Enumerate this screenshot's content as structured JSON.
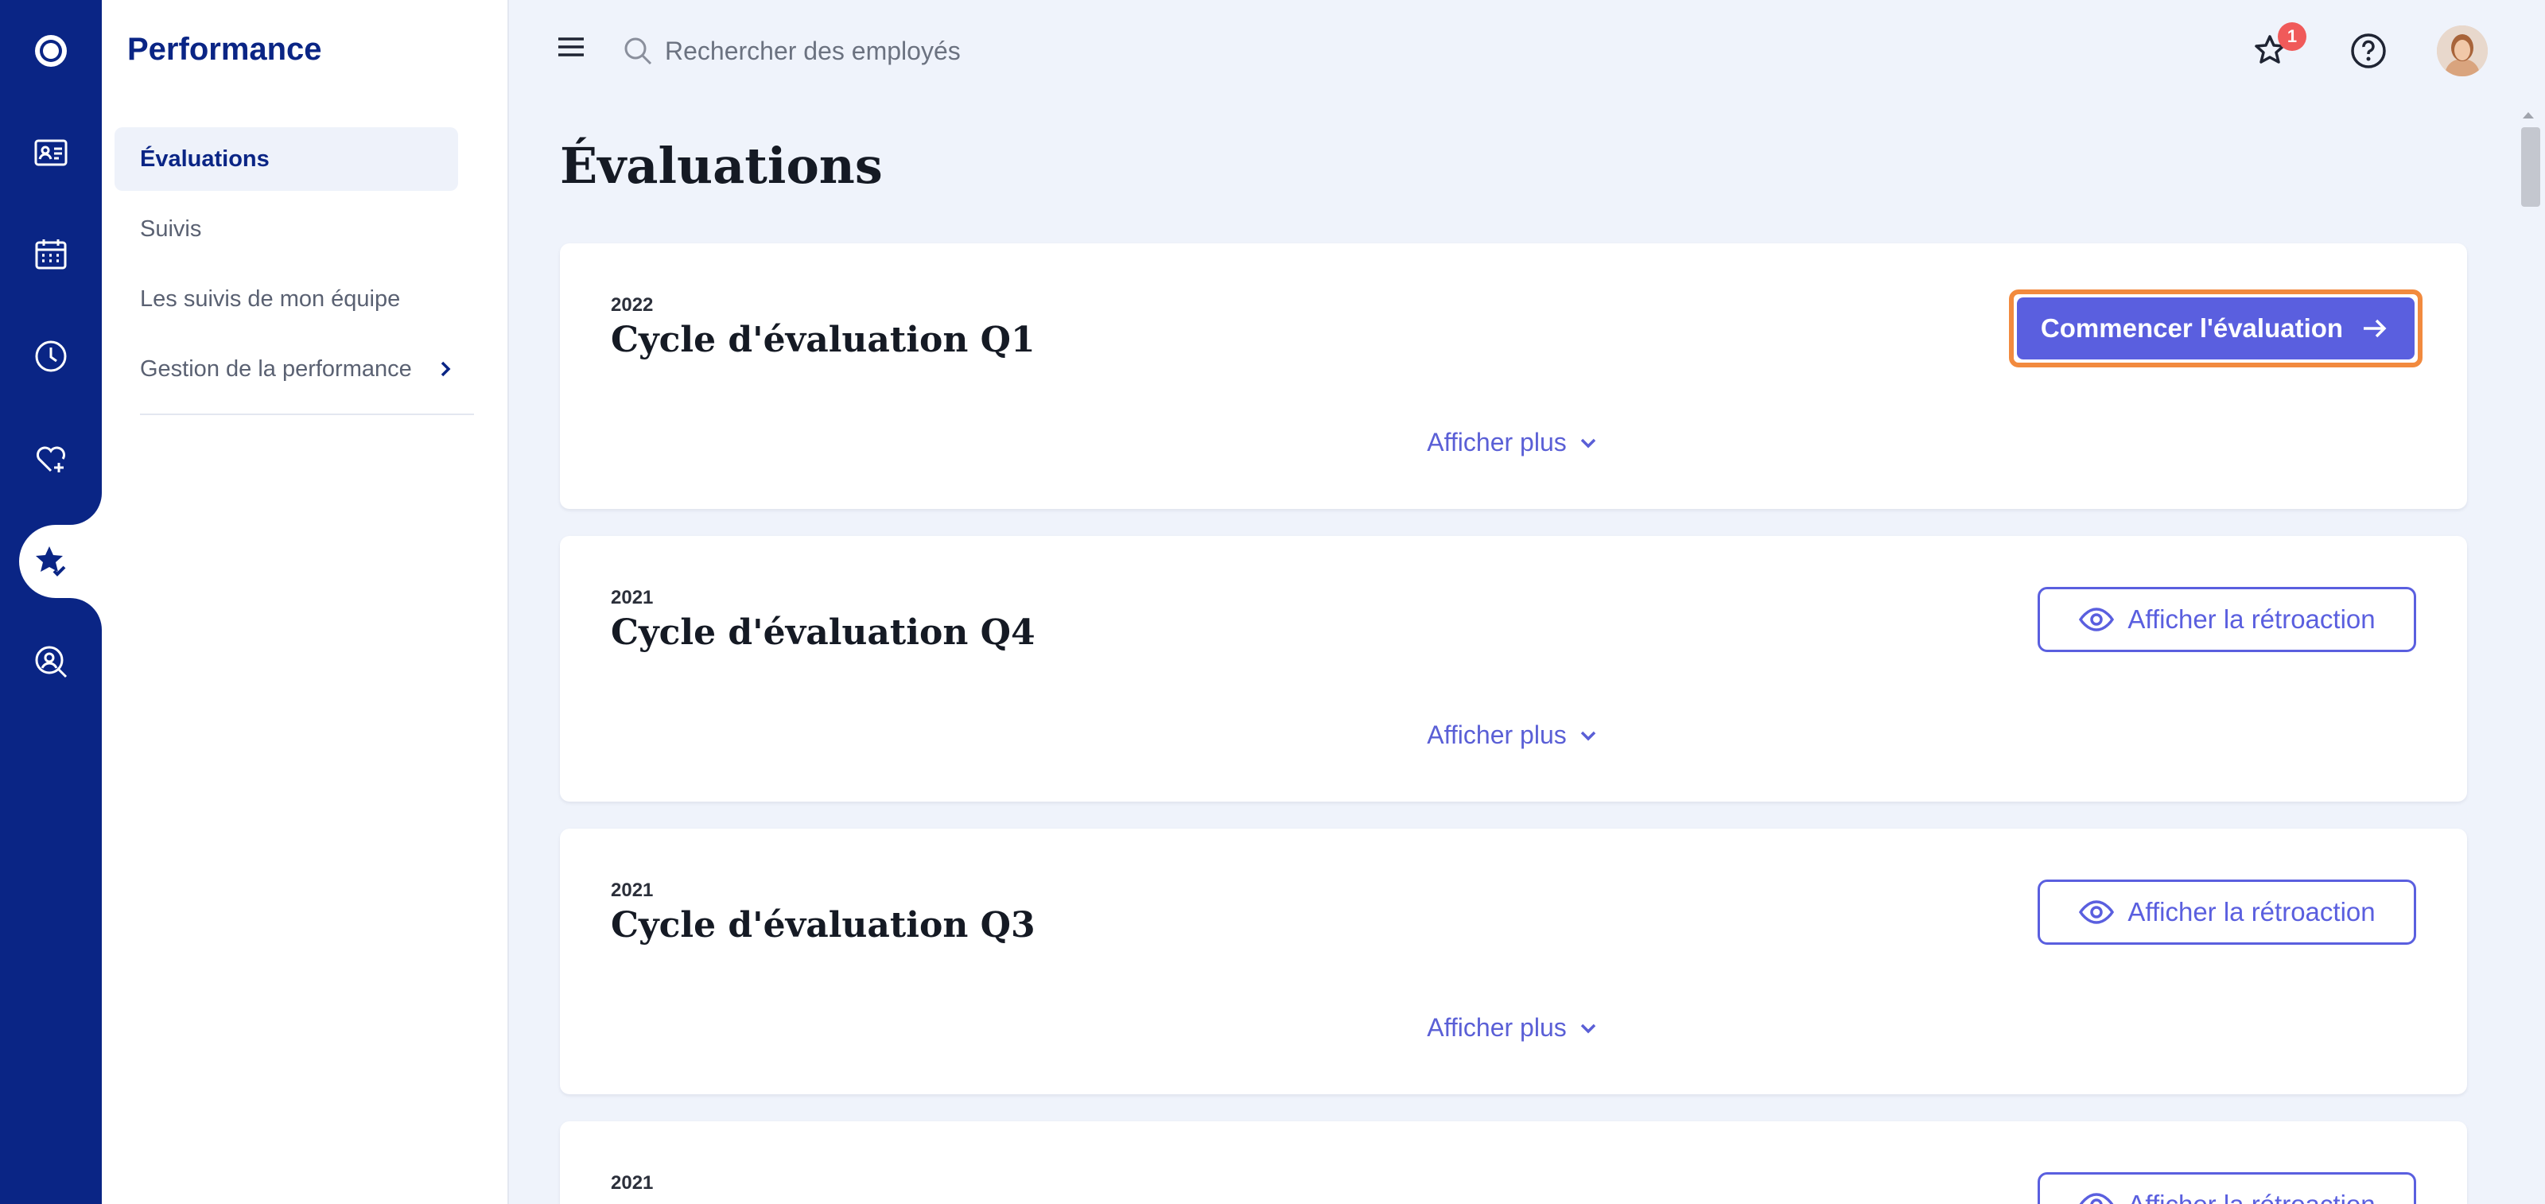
{
  "app": {
    "section_title": "Performance"
  },
  "subnav": {
    "items": [
      {
        "label": "Évaluations",
        "active": true
      },
      {
        "label": "Suivis"
      },
      {
        "label": "Les suivis de mon équipe"
      },
      {
        "label": "Gestion de la performance",
        "has_submenu": true
      }
    ]
  },
  "rail": {
    "items": [
      "logo-icon",
      "id-card-icon",
      "calendar-icon",
      "clock-icon",
      "heart-plus-icon",
      "star-check-icon",
      "search-person-icon"
    ],
    "active": "star-check-icon"
  },
  "topbar": {
    "search_placeholder": "Rechercher des employés",
    "notification_count": "1"
  },
  "page": {
    "title": "Évaluations"
  },
  "cycles": [
    {
      "year": "2022",
      "title": "Cycle d'évaluation Q1",
      "action": "Commencer l'évaluation",
      "show_more": "Afficher plus"
    },
    {
      "year": "2021",
      "title": "Cycle d'évaluation Q4",
      "action": "Afficher la rétroaction",
      "show_more": "Afficher plus"
    },
    {
      "year": "2021",
      "title": "Cycle d'évaluation Q3",
      "action": "Afficher la rétroaction",
      "show_more": "Afficher plus"
    },
    {
      "year": "2021",
      "action": "Afficher la rétroaction"
    }
  ],
  "colors": {
    "rail": "#0a2585",
    "accent": "#5a5fdf",
    "highlight": "#f28a3e",
    "badge": "#f05a5a"
  }
}
